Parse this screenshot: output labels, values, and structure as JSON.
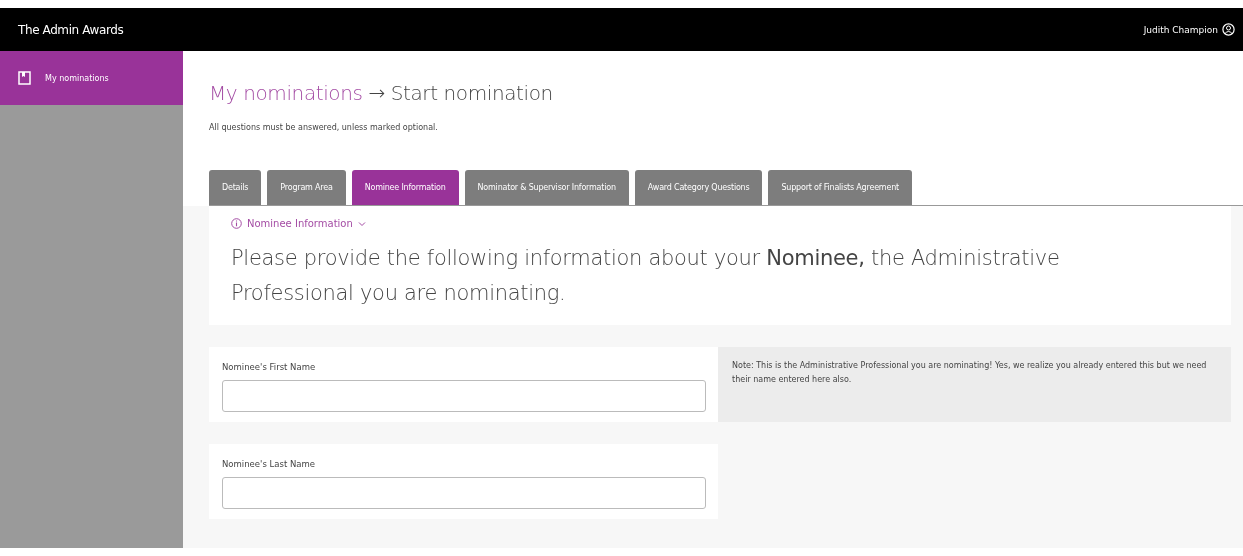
{
  "app": {
    "title": "The Admin Awards",
    "user": "Judith Champion"
  },
  "sidebar": {
    "items": [
      {
        "label": "My nominations",
        "selected": true
      }
    ]
  },
  "breadcrumb": {
    "link": "My nominations",
    "separator": "→",
    "current": "Start nomination"
  },
  "instructions": "All questions must be answered, unless marked optional.",
  "tabs": [
    {
      "label": "Details",
      "selected": false
    },
    {
      "label": "Program Area",
      "selected": false
    },
    {
      "label": "Nominee Information",
      "selected": true
    },
    {
      "label": "Nominator & Supervisor Information",
      "selected": false
    },
    {
      "label": "Award Category Questions",
      "selected": false
    },
    {
      "label": "Support of Finalists Agreement",
      "selected": false
    }
  ],
  "section": {
    "title": "Nominee Information",
    "expanded": true,
    "intro": "Please provide the following information about your **Nominee,** the Administrative Professional you are nominating."
  },
  "fields": [
    {
      "label": "Nominee's First Name",
      "note": "Note: This is the Administrative Professional you are nominating! Yes, we realize you already entered this but we need their name entered here also."
    },
    {
      "label": "Nominee's Last Name"
    }
  ]
}
